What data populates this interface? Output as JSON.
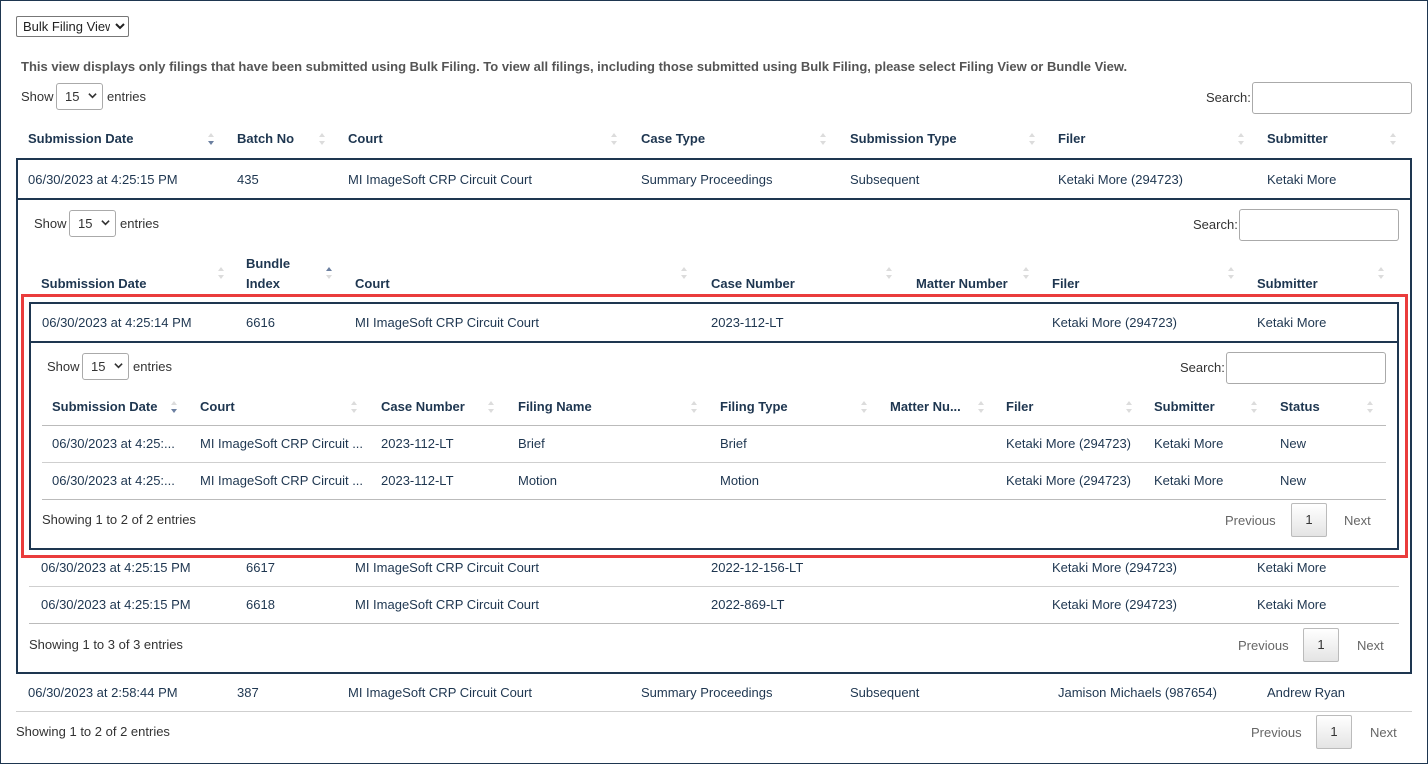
{
  "view_select": {
    "value": "Bulk Filing View"
  },
  "notice": "This view displays only filings that have been submitted using Bulk Filing. To view all filings, including those submitted using Bulk Filing, please select Filing View or Bundle View.",
  "common": {
    "show": "Show",
    "entries": "entries",
    "search": "Search:",
    "previous": "Previous",
    "next": "Next",
    "page": "1"
  },
  "outer": {
    "page_length": "15",
    "columns": [
      "Submission Date",
      "Batch No",
      "Court",
      "Case Type",
      "Submission Type",
      "Filer",
      "Submitter"
    ],
    "rows": [
      [
        "06/30/2023 at 4:25:15 PM",
        "435",
        "MI ImageSoft CRP Circuit Court",
        "Summary Proceedings",
        "Subsequent",
        "Ketaki More (294723)",
        "Ketaki More"
      ],
      [
        "06/30/2023 at 2:58:44 PM",
        "387",
        "MI ImageSoft CRP Circuit Court",
        "Summary Proceedings",
        "Subsequent",
        "Jamison Michaels (987654)",
        "Andrew Ryan"
      ]
    ],
    "info": "Showing 1 to 2 of 2 entries"
  },
  "bundle": {
    "page_length": "15",
    "columns": [
      "Submission Date",
      "Bundle Index",
      "Court",
      "Case Number",
      "Matter Number",
      "Filer",
      "Submitter"
    ],
    "bundle_index_lines": [
      "Bundle",
      "Index"
    ],
    "rows": [
      [
        "06/30/2023 at 4:25:14 PM",
        "6616",
        "MI ImageSoft CRP Circuit Court",
        "2023-112-LT",
        "",
        "Ketaki More (294723)",
        "Ketaki More"
      ],
      [
        "06/30/2023 at 4:25:15 PM",
        "6617",
        "MI ImageSoft CRP Circuit Court",
        "2022-12-156-LT",
        "",
        "Ketaki More (294723)",
        "Ketaki More"
      ],
      [
        "06/30/2023 at 4:25:15 PM",
        "6618",
        "MI ImageSoft CRP Circuit Court",
        "2022-869-LT",
        "",
        "Ketaki More (294723)",
        "Ketaki More"
      ]
    ],
    "info": "Showing 1 to 3 of 3 entries"
  },
  "filings": {
    "page_length": "15",
    "columns": [
      "Submission Date",
      "Court",
      "Case Number",
      "Filing Name",
      "Filing Type",
      "Matter Nu...",
      "Filer",
      "Submitter",
      "Status"
    ],
    "rows": [
      [
        "06/30/2023 at 4:25:...",
        "MI ImageSoft CRP Circuit ...",
        "2023-112-LT",
        "Brief",
        "Brief",
        "",
        "Ketaki More (294723)",
        "Ketaki More",
        "New"
      ],
      [
        "06/30/2023 at 4:25:...",
        "MI ImageSoft CRP Circuit ...",
        "2023-112-LT",
        "Motion",
        "Motion",
        "",
        "Ketaki More (294723)",
        "Ketaki More",
        "New"
      ]
    ],
    "info": "Showing 1 to 2 of 2 entries"
  },
  "colors": {
    "navy": "#1e3650",
    "highlight": "#ea3c3c",
    "divider": "#cfcfcf"
  },
  "icons": {
    "sort": "sort-arrows-icon",
    "dropdown": "chevron-down-icon"
  }
}
